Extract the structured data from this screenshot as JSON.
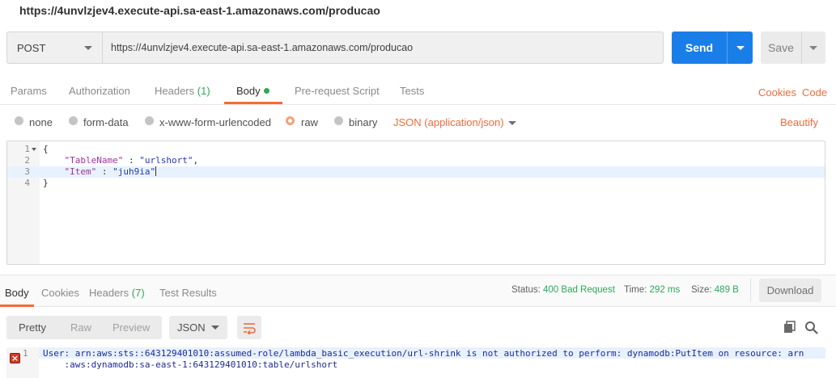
{
  "window": {
    "title": "https://4unvlzjev4.execute-api.sa-east-1.amazonaws.com/producao"
  },
  "request": {
    "method": "POST",
    "url": "https://4unvlzjev4.execute-api.sa-east-1.amazonaws.com/producao",
    "send_label": "Send",
    "save_label": "Save"
  },
  "tabs": {
    "params": "Params",
    "authorization": "Authorization",
    "headers": "Headers",
    "headers_count": "(1)",
    "body": "Body",
    "prerequest": "Pre-request Script",
    "tests": "Tests",
    "cookies": "Cookies",
    "code": "Code"
  },
  "body_options": {
    "none": "none",
    "form_data": "form-data",
    "urlencoded": "x-www-form-urlencoded",
    "raw": "raw",
    "binary": "binary",
    "content_type": "JSON (application/json)",
    "beautify": "Beautify"
  },
  "editor": {
    "line_numbers": [
      "1",
      "2",
      "3",
      "4"
    ],
    "open_brace": "{",
    "close_brace": "}",
    "key1": "\"TableName\"",
    "sep1": " : ",
    "val1": "\"urlshort\"",
    "comma": ",",
    "key2": "\"Item\"",
    "sep2": " : ",
    "val2": "\"juh9ia\""
  },
  "response": {
    "tabs": {
      "body": "Body",
      "cookies": "Cookies",
      "headers": "Headers",
      "headers_count": "(7)",
      "test_results": "Test Results"
    },
    "status_label": "Status:",
    "status_value": "400 Bad Request",
    "time_label": "Time:",
    "time_value": "292 ms",
    "size_label": "Size:",
    "size_value": "489 B",
    "download_label": "Download",
    "formats": {
      "pretty": "Pretty",
      "raw": "Raw",
      "preview": "Preview",
      "type": "JSON"
    },
    "output_line_number": "1",
    "output_line1": "User: arn:aws:sts::643129401010:assumed-role/lambda_basic_execution/url-shrink is not authorized to perform: dynamodb:PutItem on resource: arn",
    "output_line2": "    :aws:dynamodb:sa-east-1:643129401010:table/urlshort",
    "error_glyph": "×"
  },
  "colors": {
    "accent": "#f26b3a",
    "send": "#1a7ee8",
    "success": "#2aaa5a"
  }
}
